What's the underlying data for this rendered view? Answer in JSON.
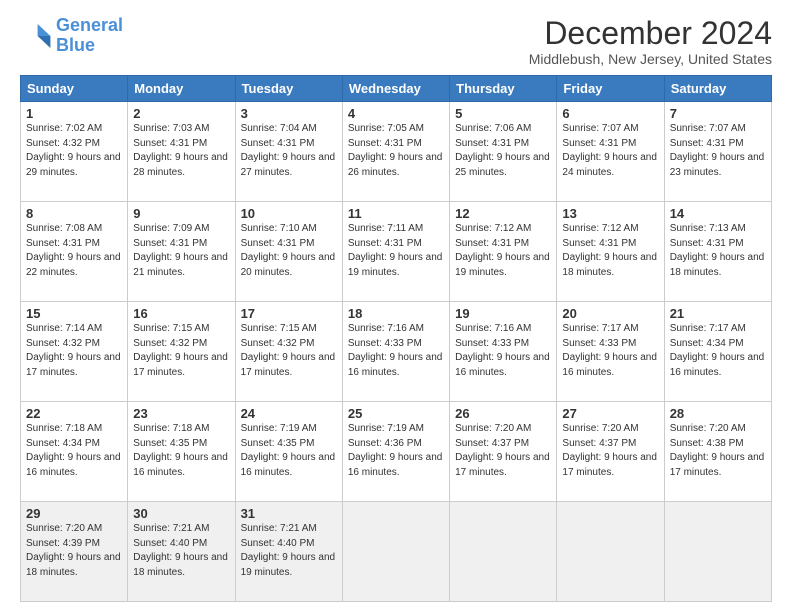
{
  "header": {
    "logo_line1": "General",
    "logo_line2": "Blue",
    "title": "December 2024",
    "subtitle": "Middlebush, New Jersey, United States"
  },
  "days_of_week": [
    "Sunday",
    "Monday",
    "Tuesday",
    "Wednesday",
    "Thursday",
    "Friday",
    "Saturday"
  ],
  "weeks": [
    [
      {
        "day": "1",
        "sunrise": "7:02 AM",
        "sunset": "4:32 PM",
        "daylight": "9 hours and 29 minutes."
      },
      {
        "day": "2",
        "sunrise": "7:03 AM",
        "sunset": "4:31 PM",
        "daylight": "9 hours and 28 minutes."
      },
      {
        "day": "3",
        "sunrise": "7:04 AM",
        "sunset": "4:31 PM",
        "daylight": "9 hours and 27 minutes."
      },
      {
        "day": "4",
        "sunrise": "7:05 AM",
        "sunset": "4:31 PM",
        "daylight": "9 hours and 26 minutes."
      },
      {
        "day": "5",
        "sunrise": "7:06 AM",
        "sunset": "4:31 PM",
        "daylight": "9 hours and 25 minutes."
      },
      {
        "day": "6",
        "sunrise": "7:07 AM",
        "sunset": "4:31 PM",
        "daylight": "9 hours and 24 minutes."
      },
      {
        "day": "7",
        "sunrise": "7:07 AM",
        "sunset": "4:31 PM",
        "daylight": "9 hours and 23 minutes."
      }
    ],
    [
      {
        "day": "8",
        "sunrise": "7:08 AM",
        "sunset": "4:31 PM",
        "daylight": "9 hours and 22 minutes."
      },
      {
        "day": "9",
        "sunrise": "7:09 AM",
        "sunset": "4:31 PM",
        "daylight": "9 hours and 21 minutes."
      },
      {
        "day": "10",
        "sunrise": "7:10 AM",
        "sunset": "4:31 PM",
        "daylight": "9 hours and 20 minutes."
      },
      {
        "day": "11",
        "sunrise": "7:11 AM",
        "sunset": "4:31 PM",
        "daylight": "9 hours and 19 minutes."
      },
      {
        "day": "12",
        "sunrise": "7:12 AM",
        "sunset": "4:31 PM",
        "daylight": "9 hours and 19 minutes."
      },
      {
        "day": "13",
        "sunrise": "7:12 AM",
        "sunset": "4:31 PM",
        "daylight": "9 hours and 18 minutes."
      },
      {
        "day": "14",
        "sunrise": "7:13 AM",
        "sunset": "4:31 PM",
        "daylight": "9 hours and 18 minutes."
      }
    ],
    [
      {
        "day": "15",
        "sunrise": "7:14 AM",
        "sunset": "4:32 PM",
        "daylight": "9 hours and 17 minutes."
      },
      {
        "day": "16",
        "sunrise": "7:15 AM",
        "sunset": "4:32 PM",
        "daylight": "9 hours and 17 minutes."
      },
      {
        "day": "17",
        "sunrise": "7:15 AM",
        "sunset": "4:32 PM",
        "daylight": "9 hours and 17 minutes."
      },
      {
        "day": "18",
        "sunrise": "7:16 AM",
        "sunset": "4:33 PM",
        "daylight": "9 hours and 16 minutes."
      },
      {
        "day": "19",
        "sunrise": "7:16 AM",
        "sunset": "4:33 PM",
        "daylight": "9 hours and 16 minutes."
      },
      {
        "day": "20",
        "sunrise": "7:17 AM",
        "sunset": "4:33 PM",
        "daylight": "9 hours and 16 minutes."
      },
      {
        "day": "21",
        "sunrise": "7:17 AM",
        "sunset": "4:34 PM",
        "daylight": "9 hours and 16 minutes."
      }
    ],
    [
      {
        "day": "22",
        "sunrise": "7:18 AM",
        "sunset": "4:34 PM",
        "daylight": "9 hours and 16 minutes."
      },
      {
        "day": "23",
        "sunrise": "7:18 AM",
        "sunset": "4:35 PM",
        "daylight": "9 hours and 16 minutes."
      },
      {
        "day": "24",
        "sunrise": "7:19 AM",
        "sunset": "4:35 PM",
        "daylight": "9 hours and 16 minutes."
      },
      {
        "day": "25",
        "sunrise": "7:19 AM",
        "sunset": "4:36 PM",
        "daylight": "9 hours and 16 minutes."
      },
      {
        "day": "26",
        "sunrise": "7:20 AM",
        "sunset": "4:37 PM",
        "daylight": "9 hours and 17 minutes."
      },
      {
        "day": "27",
        "sunrise": "7:20 AM",
        "sunset": "4:37 PM",
        "daylight": "9 hours and 17 minutes."
      },
      {
        "day": "28",
        "sunrise": "7:20 AM",
        "sunset": "4:38 PM",
        "daylight": "9 hours and 17 minutes."
      }
    ],
    [
      {
        "day": "29",
        "sunrise": "7:20 AM",
        "sunset": "4:39 PM",
        "daylight": "9 hours and 18 minutes."
      },
      {
        "day": "30",
        "sunrise": "7:21 AM",
        "sunset": "4:40 PM",
        "daylight": "9 hours and 18 minutes."
      },
      {
        "day": "31",
        "sunrise": "7:21 AM",
        "sunset": "4:40 PM",
        "daylight": "9 hours and 19 minutes."
      },
      null,
      null,
      null,
      null
    ]
  ]
}
